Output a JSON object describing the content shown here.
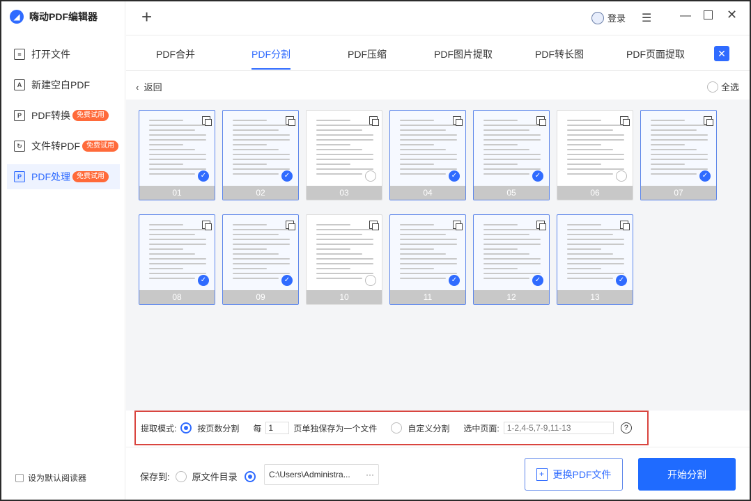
{
  "app": {
    "title": "嗨动PDF编辑器"
  },
  "sidebar": {
    "items": [
      {
        "label": "打开文件",
        "badge": ""
      },
      {
        "label": "新建空白PDF",
        "badge": ""
      },
      {
        "label": "PDF转换",
        "badge": "免费试用"
      },
      {
        "label": "文件转PDF",
        "badge": "免费试用"
      },
      {
        "label": "PDF处理",
        "badge": "免费试用"
      }
    ],
    "default_reader": "设为默认阅读器"
  },
  "header": {
    "login": "登录"
  },
  "tabs": [
    "PDF合并",
    "PDF分割",
    "PDF压缩",
    "PDF图片提取",
    "PDF转长图",
    "PDF页面提取"
  ],
  "active_tab": "PDF分割",
  "content": {
    "back": "返回",
    "select_all": "全选",
    "pages": [
      {
        "num": "01",
        "selected": true
      },
      {
        "num": "02",
        "selected": true
      },
      {
        "num": "03",
        "selected": false
      },
      {
        "num": "04",
        "selected": true
      },
      {
        "num": "05",
        "selected": true
      },
      {
        "num": "06",
        "selected": false
      },
      {
        "num": "07",
        "selected": true
      },
      {
        "num": "08",
        "selected": true
      },
      {
        "num": "09",
        "selected": true
      },
      {
        "num": "10",
        "selected": false
      },
      {
        "num": "11",
        "selected": true
      },
      {
        "num": "12",
        "selected": true
      },
      {
        "num": "13",
        "selected": true
      }
    ]
  },
  "options": {
    "mode_label": "提取模式:",
    "by_pages": "按页数分割",
    "every": "每",
    "every_value": "1",
    "per_file": "页单独保存为一个文件",
    "custom": "自定义分割",
    "selected_pages_label": "选中页面:",
    "selected_pages_value": "1-2,4-5,7-9,11-13"
  },
  "bottom": {
    "save_to": "保存到:",
    "original_dir": "原文件目录",
    "path": "C:\\Users\\Administra...",
    "dots": "···",
    "replace_btn": "更换PDF文件",
    "start_btn": "开始分割"
  },
  "colors": {
    "accent": "#2f6bff",
    "badge": "#ff6a3a",
    "highlight_border": "#d9453f"
  }
}
